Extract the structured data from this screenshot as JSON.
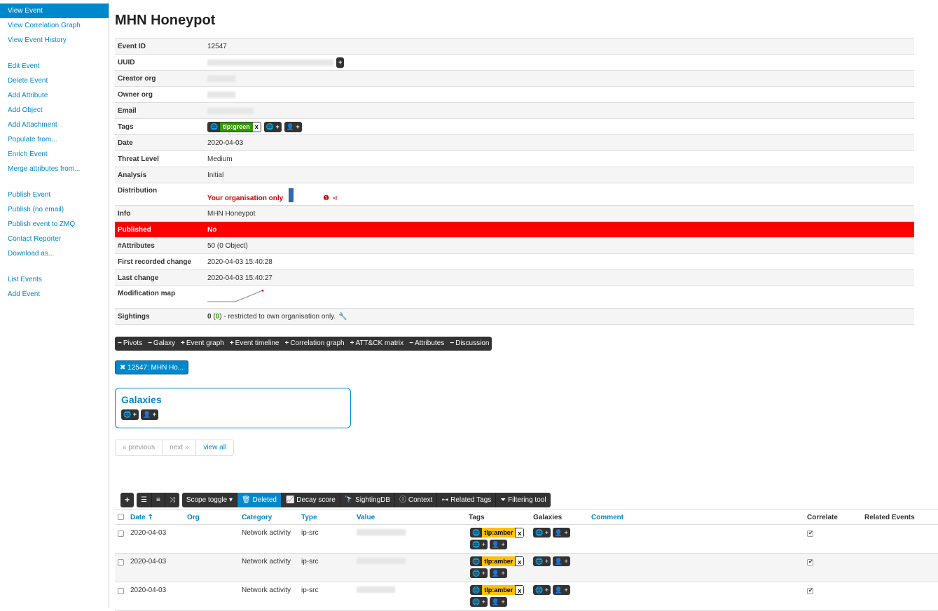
{
  "sidebar": {
    "groups": [
      [
        "View Event",
        "View Correlation Graph",
        "View Event History"
      ],
      [
        "Edit Event",
        "Delete Event",
        "Add Attribute",
        "Add Object",
        "Add Attachment",
        "Populate from...",
        "Enrich Event",
        "Merge attributes from..."
      ],
      [
        "Publish Event",
        "Publish (no email)",
        "Publish event to ZMQ",
        "Contact Reporter",
        "Download as..."
      ],
      [
        "List Events",
        "Add Event"
      ]
    ]
  },
  "event": {
    "title": "MHN Honeypot",
    "rows": {
      "event_id": {
        "label": "Event ID",
        "value": "12547"
      },
      "uuid": {
        "label": "UUID"
      },
      "creator_org": {
        "label": "Creator org"
      },
      "owner_org": {
        "label": "Owner org"
      },
      "email": {
        "label": "Email"
      },
      "tags": {
        "label": "Tags",
        "tag": "tlp:green"
      },
      "date": {
        "label": "Date",
        "value": "2020-04-03"
      },
      "threat": {
        "label": "Threat Level",
        "value": "Medium"
      },
      "analysis": {
        "label": "Analysis",
        "value": "Initial"
      },
      "distribution": {
        "label": "Distribution",
        "value": "Your organisation only"
      },
      "info": {
        "label": "Info",
        "value": "MHN Honeypot"
      },
      "published": {
        "label": "Published",
        "value": "No"
      },
      "attributes": {
        "label": "#Attributes",
        "value": "50 (0 Object)"
      },
      "first_change": {
        "label": "First recorded change",
        "value": "2020-04-03 15:40:28"
      },
      "last_change": {
        "label": "Last change",
        "value": "2020-04-03 15:40:27"
      },
      "mod_map": {
        "label": "Modification map"
      },
      "sightings": {
        "label": "Sightings",
        "count": "0",
        "paren": "0",
        "value": " - restricted to own organisation only."
      }
    }
  },
  "tabs": [
    {
      "sign": "−",
      "label": "Pivots"
    },
    {
      "sign": "−",
      "label": "Galaxy"
    },
    {
      "sign": "+",
      "label": "Event graph"
    },
    {
      "sign": "+",
      "label": "Event timeline"
    },
    {
      "sign": "+",
      "label": "Correlation graph"
    },
    {
      "sign": "+",
      "label": "ATT&CK matrix"
    },
    {
      "sign": "−",
      "label": "Attributes"
    },
    {
      "sign": "−",
      "label": "Discussion"
    }
  ],
  "pivot_chip": "12547: MHN Ho...",
  "galaxies_title": "Galaxies",
  "pager": {
    "previous": "« previous",
    "next": "next »",
    "view_all": "view all"
  },
  "attr_toolbar": {
    "scope": "Scope toggle",
    "deleted": "Deleted",
    "decay": "Decay score",
    "sightingdb": "SightingDB",
    "context": "Context",
    "related_tags": "Related Tags",
    "filtering": "Filtering tool"
  },
  "attr_table": {
    "headers": {
      "date": "Date",
      "org": "Org",
      "category": "Category",
      "type": "Type",
      "value": "Value",
      "tags": "Tags",
      "galaxies": "Galaxies",
      "comment": "Comment",
      "correlate": "Correlate",
      "related": "Related Events"
    },
    "rows": [
      {
        "date": "2020-04-03",
        "category": "Network activity",
        "type": "ip-src",
        "tag": "tlp:amber"
      },
      {
        "date": "2020-04-03",
        "category": "Network activity",
        "type": "ip-src",
        "tag": "tlp:amber"
      },
      {
        "date": "2020-04-03",
        "category": "Network activity",
        "type": "ip-src",
        "tag": "tlp:amber"
      }
    ]
  },
  "colors": {
    "accent": "#0088cc",
    "published_bg": "#ff0000",
    "tlp_green": "#339900",
    "tlp_amber": "#ffc000"
  }
}
